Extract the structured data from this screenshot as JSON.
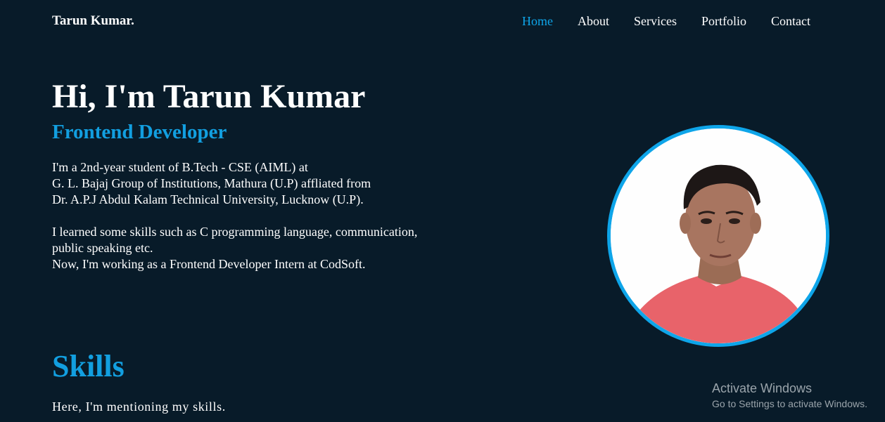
{
  "header": {
    "logo": "Tarun Kumar.",
    "nav": [
      "Home",
      "About",
      "Services",
      "Portfolio",
      "Contact"
    ],
    "active_item": "Home"
  },
  "hero": {
    "title": "Hi, I'm Tarun Kumar",
    "subtitle": "Frontend Developer",
    "lines": [
      "I'm a 2nd-year student of B.Tech - CSE (AIML) at",
      "G. L. Bajaj Group of Institutions, Mathura (U.P) affliated from",
      "Dr. A.P.J Abdul Kalam Technical University, Lucknow (U.P).",
      "",
      "I learned some skills such as C programming language, communication,",
      "public speaking etc.",
      "Now, I'm working as a Frontend Developer Intern at CodSoft."
    ]
  },
  "skills": {
    "title": "Skills",
    "description": "Here, I'm mentioning my skills."
  },
  "watermark": {
    "title": "Activate Windows",
    "subtitle": "Go to Settings to activate Windows."
  },
  "colors": {
    "background": "#081b29",
    "accent": "#0ea5e9",
    "text": "#ffffff"
  }
}
